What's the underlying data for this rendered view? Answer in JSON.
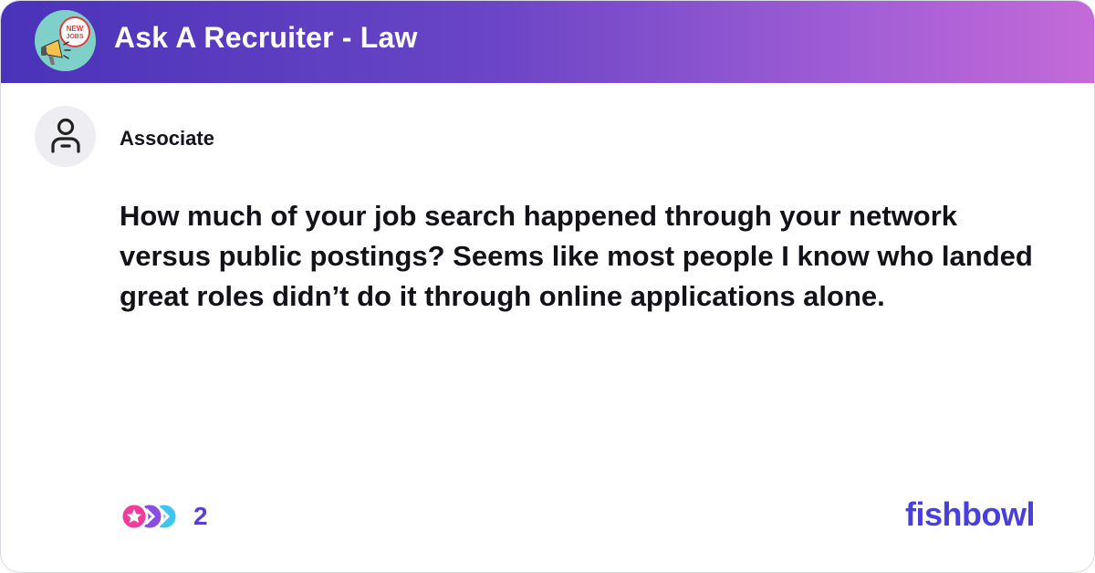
{
  "header": {
    "title": "Ask A Recruiter - Law",
    "avatar_badge_text": [
      "NEW",
      "JOBS"
    ],
    "avatar_icon": "megaphone-icon"
  },
  "post": {
    "author_title": "Associate",
    "author_avatar_icon": "user-icon",
    "text": "How much of your job search happened through your network versus public postings? Seems like most people I know who landed great roles didn’t do it through online applications alone."
  },
  "footer": {
    "reactions_icon": "reactions-icon",
    "reaction_count": "2",
    "brand": "fishbowl"
  },
  "colors": {
    "header_gradient_start": "#4a33b9",
    "header_gradient_end": "#c46ad8",
    "brand": "#4b3ee0",
    "count": "#5a3fd2"
  }
}
